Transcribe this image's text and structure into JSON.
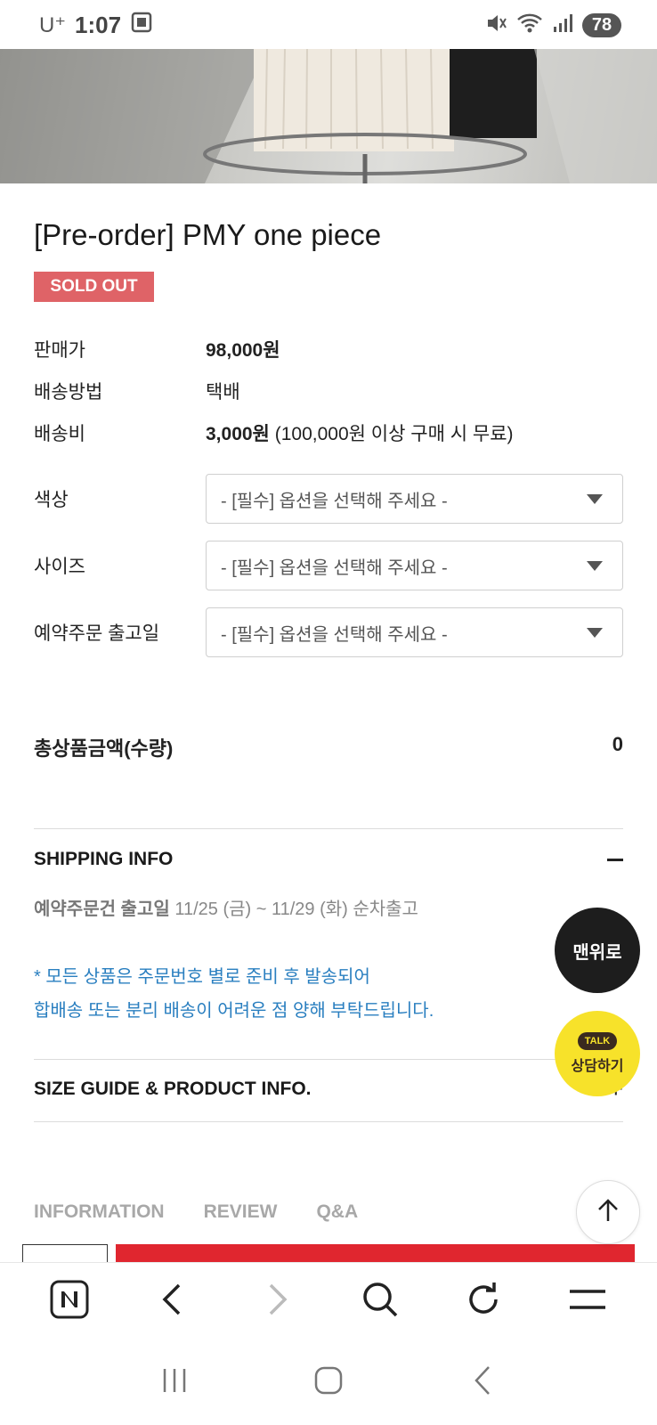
{
  "status": {
    "carrier": "U⁺",
    "time": "1:07",
    "battery": "78",
    "icons": [
      "screenshot-icon",
      "mute-icon",
      "wifi-icon",
      "signal-icon"
    ]
  },
  "product": {
    "title": "[Pre-order] PMY one piece",
    "badge": "SOLD OUT",
    "price_label": "판매가",
    "price_value": "98,000원",
    "shipping_method_label": "배송방법",
    "shipping_method_value": "택배",
    "shipping_fee_label": "배송비",
    "shipping_fee_value": "3,000원",
    "shipping_fee_note": "(100,000원 이상 구매 시 무료)"
  },
  "options": [
    {
      "label": "색상",
      "placeholder": "- [필수] 옵션을 선택해 주세요 -"
    },
    {
      "label": "사이즈",
      "placeholder": "- [필수] 옵션을 선택해 주세요 -"
    },
    {
      "label": "예약주문 출고일",
      "placeholder": "- [필수] 옵션을 선택해 주세요 -"
    }
  ],
  "total": {
    "label": "총상품금액(수량)",
    "value": "0"
  },
  "shipping_info": {
    "title": "SHIPPING INFO",
    "release_label": "예약주문건 출고일",
    "release_value": "11/25 (금) ~ 11/29 (화) 순차출고",
    "notice_line1": "* 모든 상품은 주문번호 별로 준비 후 발송되어",
    "notice_line2": "합배송 또는 분리 배송이 어려운 점 양해 부탁드립니다."
  },
  "size_guide": {
    "title": "SIZE GUIDE & PRODUCT INFO.",
    "toggle": "+"
  },
  "tabs": [
    "INFORMATION",
    "REVIEW",
    "Q&A"
  ],
  "floating": {
    "top_label": "맨위로",
    "talk_badge": "TALK",
    "talk_label": "상담하기"
  },
  "colors": {
    "sold_out": "#df6367",
    "notice": "#2a7fc0",
    "buy": "#e0262f",
    "talk": "#f7e22a"
  }
}
